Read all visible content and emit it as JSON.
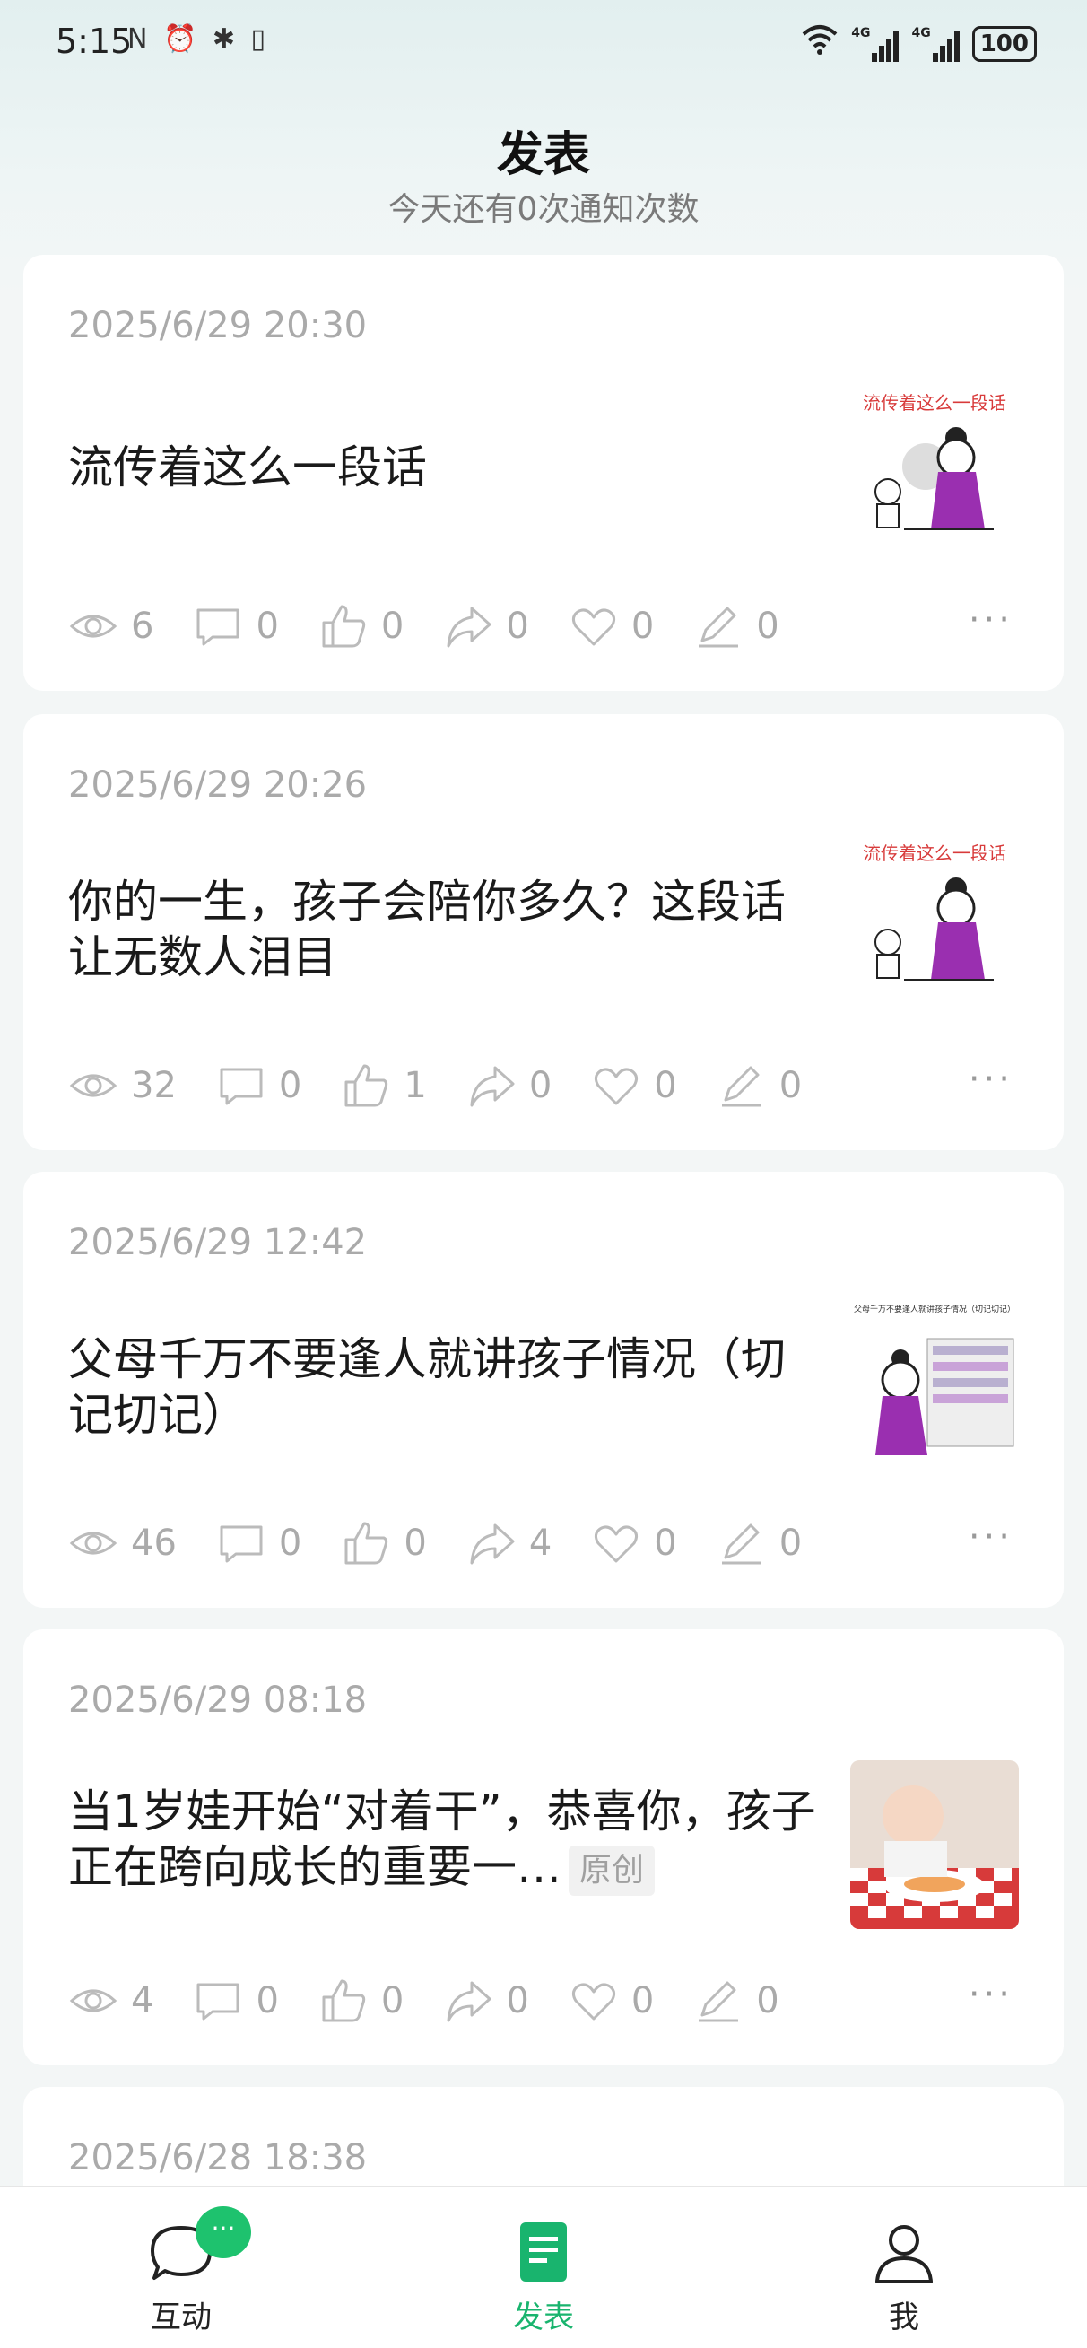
{
  "status_bar": {
    "time": "5:15",
    "left_icons": "N ⏰ ✱ ▯",
    "network_1": "4G",
    "network_2": "4G",
    "battery": "100"
  },
  "header": {
    "title": "发表",
    "subtitle": "今天还有0次通知次数"
  },
  "posts": [
    {
      "date": "2025/6/29 20:30",
      "title": "流传着这么一段话",
      "badge": "",
      "thumb_caption": "流传着这么一段话",
      "stats": {
        "views": "6",
        "comments": "0",
        "likes": "0",
        "shares": "0",
        "favorites": "0",
        "edits": "0"
      }
    },
    {
      "date": "2025/6/29 20:26",
      "title": "你的一生，孩子会陪你多久？这段话让无数人泪目",
      "badge": "",
      "thumb_caption": "流传着这么一段话",
      "stats": {
        "views": "32",
        "comments": "0",
        "likes": "1",
        "shares": "0",
        "favorites": "0",
        "edits": "0"
      }
    },
    {
      "date": "2025/6/29 12:42",
      "title": "父母千万不要逢人就讲孩子情况（切记切记）",
      "badge": "",
      "thumb_caption": "父母千万不要逢人就讲孩子情况（切记切记）",
      "stats": {
        "views": "46",
        "comments": "0",
        "likes": "0",
        "shares": "4",
        "favorites": "0",
        "edits": "0"
      }
    },
    {
      "date": "2025/6/29 08:18",
      "title": "当1岁娃开始“对着干”，恭喜你，孩子正在跨向成长的重要一…",
      "badge": "原创",
      "thumb_caption": "",
      "stats": {
        "views": "4",
        "comments": "0",
        "likes": "0",
        "shares": "0",
        "favorites": "0",
        "edits": "0"
      }
    },
    {
      "date": "2025/6/28 18:38"
    }
  ],
  "more_label": "···",
  "bottom_nav": {
    "interact": "互动",
    "interact_badge": "···",
    "publish": "发表",
    "me": "我"
  },
  "colors": {
    "accent": "#19b46e",
    "badge_green": "#1ec26e",
    "muted_text": "#aaaaaa"
  }
}
